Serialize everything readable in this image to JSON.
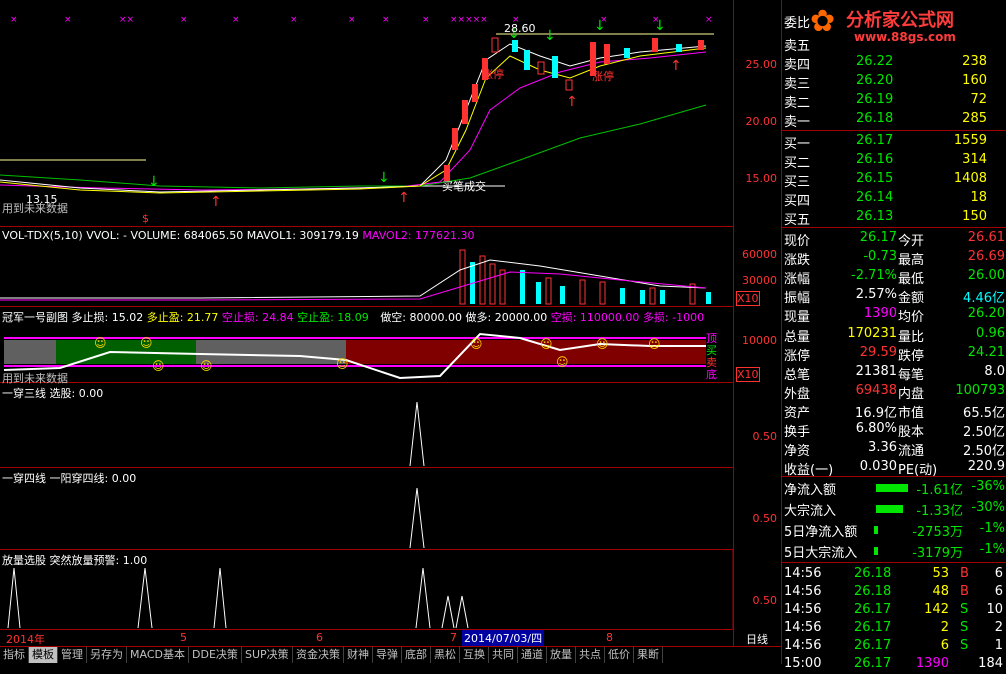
{
  "logo": {
    "text": "分析家公式网",
    "url": "www.88gs.com"
  },
  "main_chart": {
    "axis": [
      "25.00",
      "20.00",
      "15.00"
    ],
    "high_label": "28.60",
    "low_label": "13.15",
    "signal_labels": {
      "buy_close": "买笔成交",
      "limit_up": "涨停",
      "limit_up_2": "涨停",
      "use_note": "用到未来数据"
    },
    "marker_s": "$"
  },
  "vol_panel": {
    "title": "VOL-TDX(5,10)",
    "vvol": "VVOL: -",
    "volume": "VOLUME: 684065.50",
    "mavol1": "MAVOL1: 309179.19",
    "mavol2": "MAVOL2: 177621.30",
    "axis": [
      "60000",
      "30000"
    ],
    "unit": "X10"
  },
  "champ_panel": {
    "title": "冠军一号副图",
    "long_stop": "多止损: 15.02",
    "long_take": "多止盈: 21.77",
    "short_stop": "空止损: 24.84",
    "short_take": "空止盈: 18.09",
    "do_short": "做空: 80000.00",
    "do_long": "做多: 20000.00",
    "empty_loss": "空损: 110000.00",
    "long_loss": "多损: -1000",
    "axis": [
      "10000"
    ],
    "unit": "X10",
    "side_top": "顶",
    "side_mid": "买",
    "side_low": "卖",
    "side_bottom": "底",
    "note": "用到未来数据"
  },
  "panel3": {
    "title": "一穿三线",
    "sub": "选股: 0.00",
    "axis": "0.50"
  },
  "panel4": {
    "title": "一穿四线",
    "sub": "一阳穿四线: 0.00",
    "axis": "0.50"
  },
  "panel5": {
    "title": "放量选股",
    "sub": "突然放量预警: 1.00",
    "axis": "0.50"
  },
  "date_axis": {
    "year": "2014年",
    "months": [
      "5",
      "6",
      "7",
      "8"
    ],
    "cursor_date": "2014/07/03/四",
    "period": "日线"
  },
  "order_book": {
    "header": "委比",
    "sells": [
      {
        "label": "卖四",
        "price": "26.22",
        "vol": "238"
      },
      {
        "label": "卖三",
        "price": "26.20",
        "vol": "160"
      },
      {
        "label": "卖二",
        "price": "26.19",
        "vol": "72"
      },
      {
        "label": "卖一",
        "price": "26.18",
        "vol": "285"
      }
    ],
    "sell_top_label": "卖五",
    "buys": [
      {
        "label": "买一",
        "price": "26.17",
        "vol": "1559"
      },
      {
        "label": "买二",
        "price": "26.16",
        "vol": "314"
      },
      {
        "label": "买三",
        "price": "26.15",
        "vol": "1408"
      },
      {
        "label": "买四",
        "price": "26.14",
        "vol": "18"
      },
      {
        "label": "买五",
        "price": "26.13",
        "vol": "150"
      }
    ]
  },
  "stats": [
    {
      "l1": "现价",
      "v1": "26.17",
      "c1": "green",
      "l2": "今开",
      "v2": "26.61",
      "c2": "red"
    },
    {
      "l1": "涨跌",
      "v1": "-0.73",
      "c1": "green",
      "l2": "最高",
      "v2": "26.69",
      "c2": "red"
    },
    {
      "l1": "涨幅",
      "v1": "-2.71%",
      "c1": "green",
      "l2": "最低",
      "v2": "26.00",
      "c2": "green"
    },
    {
      "l1": "振幅",
      "v1": "2.57%",
      "c1": "white",
      "l2": "金额",
      "v2": "4.46亿",
      "c2": "cyan"
    },
    {
      "l1": "现量",
      "v1": "1390",
      "c1": "mag",
      "l2": "均价",
      "v2": "26.20",
      "c2": "green"
    },
    {
      "l1": "总量",
      "v1": "170231",
      "c1": "yellow",
      "l2": "量比",
      "v2": "0.96",
      "c2": "green"
    },
    {
      "l1": "涨停",
      "v1": "29.59",
      "c1": "red",
      "l2": "跌停",
      "v2": "24.21",
      "c2": "green"
    },
    {
      "l1": "总笔",
      "v1": "21381",
      "c1": "white",
      "l2": "每笔",
      "v2": "8.0",
      "c2": "white"
    },
    {
      "l1": "外盘",
      "v1": "69438",
      "c1": "red",
      "l2": "内盘",
      "v2": "100793",
      "c2": "green"
    },
    {
      "l1": "资产",
      "v1": "16.9亿",
      "c1": "white",
      "l2": "市值",
      "v2": "65.5亿",
      "c2": "white"
    },
    {
      "l1": "换手",
      "v1": "6.80%",
      "c1": "white",
      "l2": "股本",
      "v2": "2.50亿",
      "c2": "white"
    },
    {
      "l1": "净资",
      "v1": "3.36",
      "c1": "white",
      "l2": "流通",
      "v2": "2.50亿",
      "c2": "white"
    },
    {
      "l1": "收益(一)",
      "v1": "0.030",
      "c1": "white",
      "l2": "PE(动)",
      "v2": "220.9",
      "c2": "white"
    }
  ],
  "flows": [
    {
      "label": "净流入额",
      "value": "-1.61亿",
      "pct": "-36%",
      "bar": 0.36
    },
    {
      "label": "大宗流入",
      "value": "-1.33亿",
      "pct": "-30%",
      "bar": 0.3
    },
    {
      "label": "5日净流入额",
      "value": "-2753万",
      "pct": "-1%",
      "bar": 0.03
    },
    {
      "label": "5日大宗流入",
      "value": "-3179万",
      "pct": "-1%",
      "bar": 0.03
    }
  ],
  "ticks": [
    {
      "time": "14:56",
      "price": "26.18",
      "vol": "53",
      "side": "B",
      "n": "6"
    },
    {
      "time": "14:56",
      "price": "26.18",
      "vol": "48",
      "side": "B",
      "n": "6"
    },
    {
      "time": "14:56",
      "price": "26.17",
      "vol": "142",
      "side": "S",
      "n": "10"
    },
    {
      "time": "14:56",
      "price": "26.17",
      "vol": "2",
      "side": "S",
      "n": "2"
    },
    {
      "time": "14:56",
      "price": "26.17",
      "vol": "6",
      "side": "S",
      "n": "1"
    },
    {
      "time": "15:00",
      "price": "26.17",
      "vol": "1390",
      "side": "",
      "n": "184"
    }
  ],
  "tabs": [
    "指标",
    "模板",
    "管理",
    "另存为",
    "MACD基本",
    "DDE决策",
    "SUP决策",
    "资金决策",
    "财神",
    "导弹",
    "底部",
    "黑松",
    "互换",
    "共同",
    "通道",
    "放量",
    "共点",
    "低价",
    "果断"
  ],
  "active_tab": 1,
  "colors": {
    "up": "#ff3232",
    "down": "#00e600",
    "grid": "#a00000",
    "accent_yellow": "#ffff00"
  }
}
